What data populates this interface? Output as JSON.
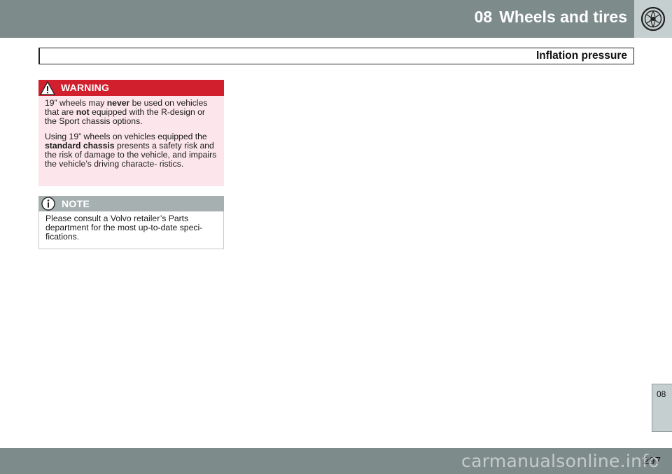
{
  "header": {
    "chapter_number": "08",
    "chapter_title": "Wheels and tires",
    "chapter_icon": "steering-wheel-icon"
  },
  "section": {
    "title": "Inflation pressure"
  },
  "warning": {
    "label": "WARNING",
    "icon": "warning-triangle-icon",
    "p1": {
      "a": "19” wheels may ",
      "b": "never",
      "c": " be used on vehicles that are ",
      "d": "not",
      "e": " equipped with the R-design or the Sport chassis options."
    },
    "p2": {
      "a": "Using 19” wheels on vehicles equipped the ",
      "b": "standard chassis",
      "c": " presents a safety risk and the risk of damage to the vehicle, and impairs the vehicle’s driving characte- ristics."
    }
  },
  "note": {
    "label": "NOTE",
    "icon": "info-icon",
    "text": "Please consult a Volvo retailer’s Parts department for the most up-to-date speci- fications."
  },
  "side_tab": {
    "label": "08"
  },
  "footer": {
    "page_number": "297",
    "watermark": "carmanualsonline.info"
  },
  "colors": {
    "bar": "#7e8b8b",
    "warning_red": "#d21f2e",
    "warning_bg": "#fce6ec",
    "note_head": "#a6b0b0"
  }
}
